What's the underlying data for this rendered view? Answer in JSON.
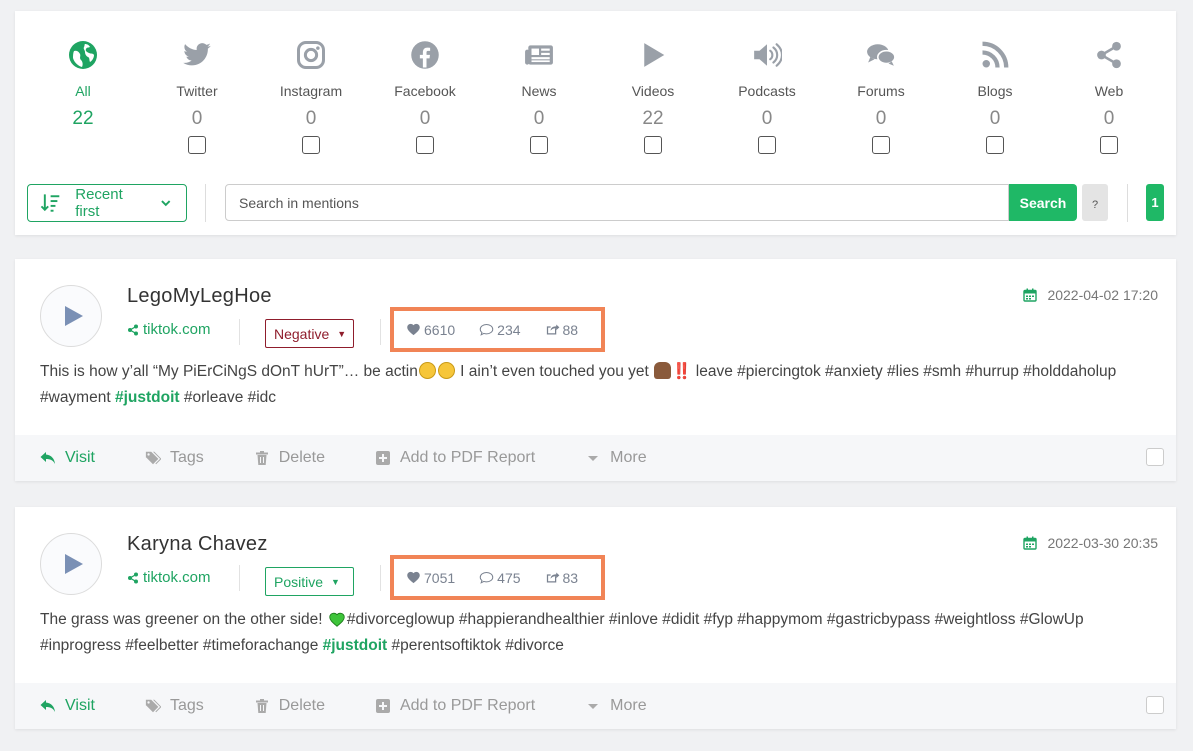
{
  "colors": {
    "accent": "#1fa462",
    "negative": "#8f1d2c",
    "highlight_box": "#f18456"
  },
  "sources": [
    {
      "label": "All",
      "count": "22",
      "icon": "globe-icon"
    },
    {
      "label": "Twitter",
      "count": "0",
      "icon": "twitter-icon"
    },
    {
      "label": "Instagram",
      "count": "0",
      "icon": "instagram-icon"
    },
    {
      "label": "Facebook",
      "count": "0",
      "icon": "facebook-icon"
    },
    {
      "label": "News",
      "count": "0",
      "icon": "newspaper-icon"
    },
    {
      "label": "Videos",
      "count": "22",
      "icon": "play-icon"
    },
    {
      "label": "Podcasts",
      "count": "0",
      "icon": "speaker-icon"
    },
    {
      "label": "Forums",
      "count": "0",
      "icon": "comments-icon"
    },
    {
      "label": "Blogs",
      "count": "0",
      "icon": "rss-icon"
    },
    {
      "label": "Web",
      "count": "0",
      "icon": "share-icon"
    }
  ],
  "toolbar": {
    "sort_label": "Recent first",
    "search_placeholder": "Search in mentions",
    "search_button": "Search",
    "help_button": "?",
    "page_number": "1"
  },
  "mentions": [
    {
      "author": "LegoMyLegHoe",
      "domain": "tiktok.com",
      "sentiment": "Negative",
      "likes": "6610",
      "comments": "234",
      "shares": "88",
      "date": "2022-04-02 17:20",
      "text_parts": [
        "This is how y’all “My PiErCiNgS dOnT hUrT”… be actin",
        " I ain’t even touched you yet ",
        "‼️ leave #piercingtok #anxiety #lies #smh #hurrup #holddaholup #wayment ",
        "#justdoit",
        " #orleave #idc"
      ]
    },
    {
      "author": "Karyna Chavez",
      "domain": "tiktok.com",
      "sentiment": "Positive",
      "likes": "7051",
      "comments": "475",
      "shares": "83",
      "date": "2022-03-30 20:35",
      "text_parts": [
        "The grass was greener on the other side! ",
        "#divorceglowup #happierandhealthier #inlove #didit #fyp #happymom #gastricbypass #weightloss #GlowUp #inprogress #feelbetter #timeforachange ",
        "#justdoit",
        " #perentsoftiktok #divorce"
      ]
    }
  ],
  "actions": {
    "visit": "Visit",
    "tags": "Tags",
    "delete": "Delete",
    "pdf": "Add to PDF Report",
    "more": "More"
  }
}
